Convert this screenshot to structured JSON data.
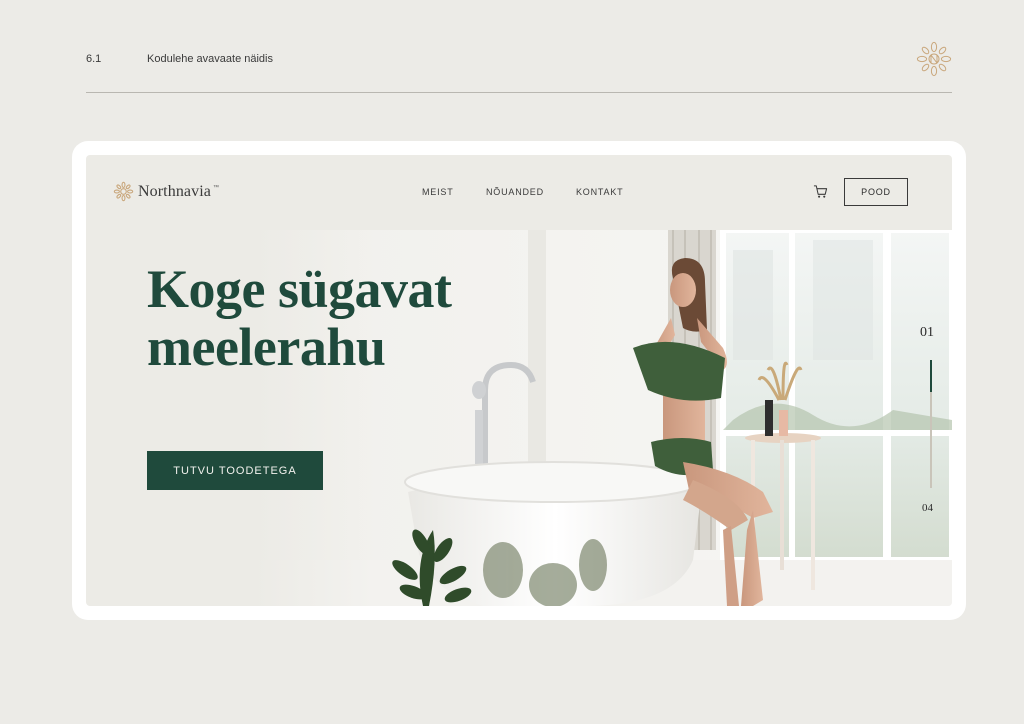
{
  "sheet": {
    "number": "6.1",
    "title": "Kodulehe avavaate näidis",
    "emblem_icon": "botanical-emblem-icon"
  },
  "site": {
    "brand": {
      "name": "Northnavia",
      "trademark": "™",
      "logo_icon": "botanical-logo-icon"
    },
    "nav": {
      "items": [
        "MEIST",
        "NÕUANDED",
        "KONTAKT"
      ],
      "cart_icon": "cart-icon",
      "shop_label": "POOD"
    },
    "hero": {
      "headline": "Koge sügavat meelerahu",
      "cta_label": "TUTVU TOODETEGA",
      "image": "hero-photo"
    },
    "slider": {
      "current": "01",
      "total": "04",
      "progress": 0.25
    },
    "colors": {
      "brand_green": "#1f4a3c",
      "background": "#ecebe6",
      "accent_gold": "#c9a77c"
    }
  }
}
